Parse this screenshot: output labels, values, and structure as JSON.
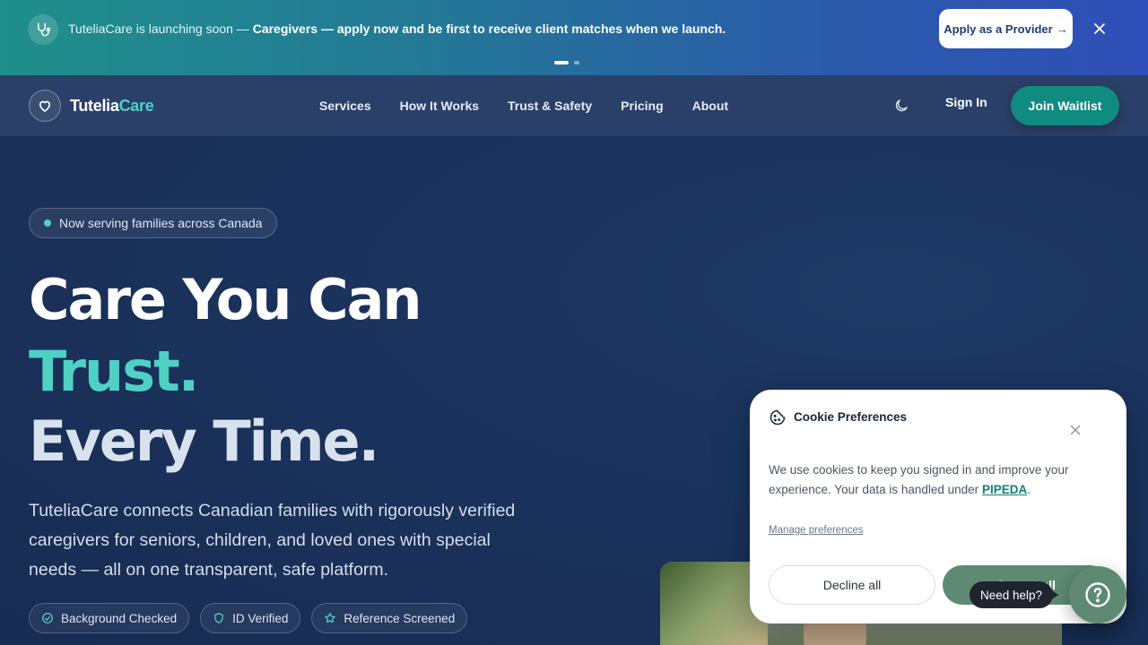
{
  "announcement": {
    "prefix": "TuteliaCare is launching soon — ",
    "highlight": "Caregivers — apply now and be first to receive client matches when we launch.",
    "cta_label": "Apply as a Provider",
    "cta_arrow": "→",
    "slides": 2,
    "active_slide": 1
  },
  "nav": {
    "logo_primary": "Tutelia",
    "logo_secondary": "Care",
    "links": [
      "Services",
      "How It Works",
      "Trust & Safety",
      "Pricing",
      "About"
    ],
    "sign_in": "Sign In",
    "join": "Join Waitlist"
  },
  "hero": {
    "pill": "Now serving families across Canada",
    "headline_1": "Care You Can",
    "headline_2": "Trust.",
    "headline_3": "Every Time.",
    "description": "TuteliaCare connects Canadian families with rigorously verified caregivers for seniors, children, and loved ones with special needs — all on one transparent, safe platform.",
    "badges": [
      {
        "label": "Background Checked",
        "icon": "check-circle-icon"
      },
      {
        "label": "ID Verified",
        "icon": "shield-icon"
      },
      {
        "label": "Reference Screened",
        "icon": "star-icon"
      }
    ]
  },
  "cookie": {
    "title": "Cookie Preferences",
    "text_before": "We use cookies to keep you signed in and improve your experience. Your data is handled under ",
    "link": "PIPEDA",
    "text_after": ".",
    "manage": "Manage preferences",
    "decline": "Decline all",
    "accept": "Accept all"
  },
  "help": {
    "label": "Need help?"
  },
  "colors": {
    "accent": "#4fd1c5",
    "primary_button": "#0f8b80",
    "navy": "#1b335d",
    "cookie_accept": "#5e8a72"
  }
}
